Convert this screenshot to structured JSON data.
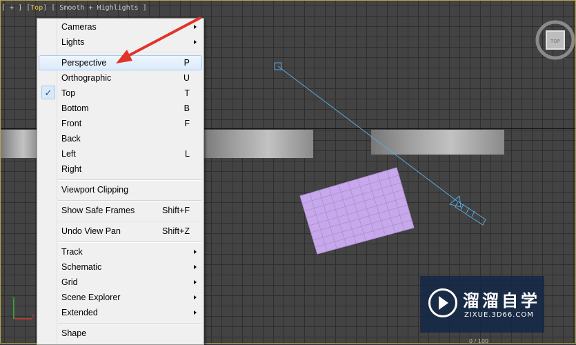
{
  "viewport": {
    "label_prefix": "[ + ] [",
    "label_view": "Top",
    "label_suffix": "] [ Smooth + Highlights ]",
    "viewcube_label": "TOP",
    "status_fragment": "0 / 100"
  },
  "context_menu": {
    "items": [
      {
        "label": "Cameras",
        "shortcut": "",
        "submenu": true
      },
      {
        "label": "Lights",
        "shortcut": "",
        "submenu": true
      },
      {
        "label": "Perspective",
        "shortcut": "P",
        "submenu": false,
        "highlighted": true
      },
      {
        "label": "Orthographic",
        "shortcut": "U",
        "submenu": false
      },
      {
        "label": "Top",
        "shortcut": "T",
        "submenu": false,
        "checked": true
      },
      {
        "label": "Bottom",
        "shortcut": "B",
        "submenu": false
      },
      {
        "label": "Front",
        "shortcut": "F",
        "submenu": false
      },
      {
        "label": "Back",
        "shortcut": "",
        "submenu": false
      },
      {
        "label": "Left",
        "shortcut": "L",
        "submenu": false
      },
      {
        "label": "Right",
        "shortcut": "",
        "submenu": false
      },
      {
        "label": "Viewport Clipping",
        "shortcut": "",
        "submenu": false
      },
      {
        "label": "Show Safe Frames",
        "shortcut": "Shift+F",
        "submenu": false
      },
      {
        "label": "Undo View Pan",
        "shortcut": "Shift+Z",
        "submenu": false
      },
      {
        "label": "Track",
        "shortcut": "",
        "submenu": true
      },
      {
        "label": "Schematic",
        "shortcut": "",
        "submenu": true
      },
      {
        "label": "Grid",
        "shortcut": "",
        "submenu": true
      },
      {
        "label": "Scene Explorer",
        "shortcut": "",
        "submenu": true
      },
      {
        "label": "Extended",
        "shortcut": "",
        "submenu": true
      },
      {
        "label": "Shape",
        "shortcut": "",
        "submenu": false
      }
    ],
    "check_mark": "✓"
  },
  "watermark": {
    "title": "溜溜自学",
    "url": "ZIXUE.3D66.COM"
  },
  "colors": {
    "plane_fill": "#c8a8ec",
    "camera_line": "#5aa9e0",
    "annotation_arrow": "#e0342a",
    "active_view_label": "#e8c84a"
  },
  "icons": [
    "checkmark-icon",
    "submenu-arrow-icon",
    "viewcube-icon",
    "axis-tripod-icon",
    "camera-icon",
    "target-icon",
    "play-logo-icon"
  ]
}
